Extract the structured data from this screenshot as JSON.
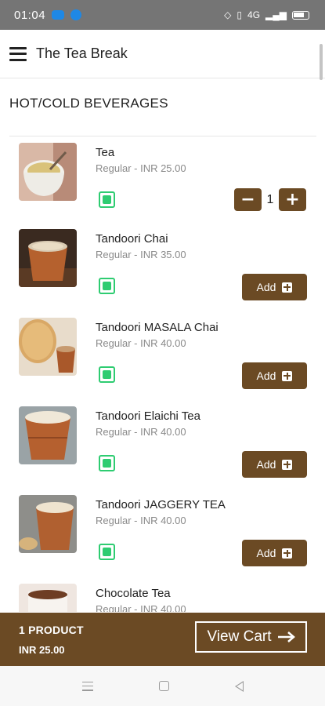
{
  "status_bar": {
    "time": "01:04",
    "signal_text": "4G"
  },
  "header": {
    "title": "The Tea Break"
  },
  "section": {
    "title": "HOT/COLD BEVERAGES"
  },
  "products": [
    {
      "name": "Tea",
      "price": "Regular - INR 25.00",
      "quantity": "1"
    },
    {
      "name": "Tandoori Chai",
      "price": "Regular - INR 35.00",
      "add_label": "Add"
    },
    {
      "name": "Tandoori MASALA Chai",
      "price": "Regular - INR 40.00",
      "add_label": "Add"
    },
    {
      "name": "Tandoori Elaichi Tea",
      "price": "Regular - INR 40.00",
      "add_label": "Add"
    },
    {
      "name": "Tandoori JAGGERY TEA",
      "price": "Regular - INR 40.00",
      "add_label": "Add"
    },
    {
      "name": "Chocolate Tea",
      "price": "Regular - INR 40.00"
    }
  ],
  "cart": {
    "count_label": "1 PRODUCT",
    "total": "INR 25.00",
    "view_cart_label": "View Cart"
  },
  "colors": {
    "brand_brown": "#6b4a24",
    "veg_green": "#2ecc71"
  }
}
